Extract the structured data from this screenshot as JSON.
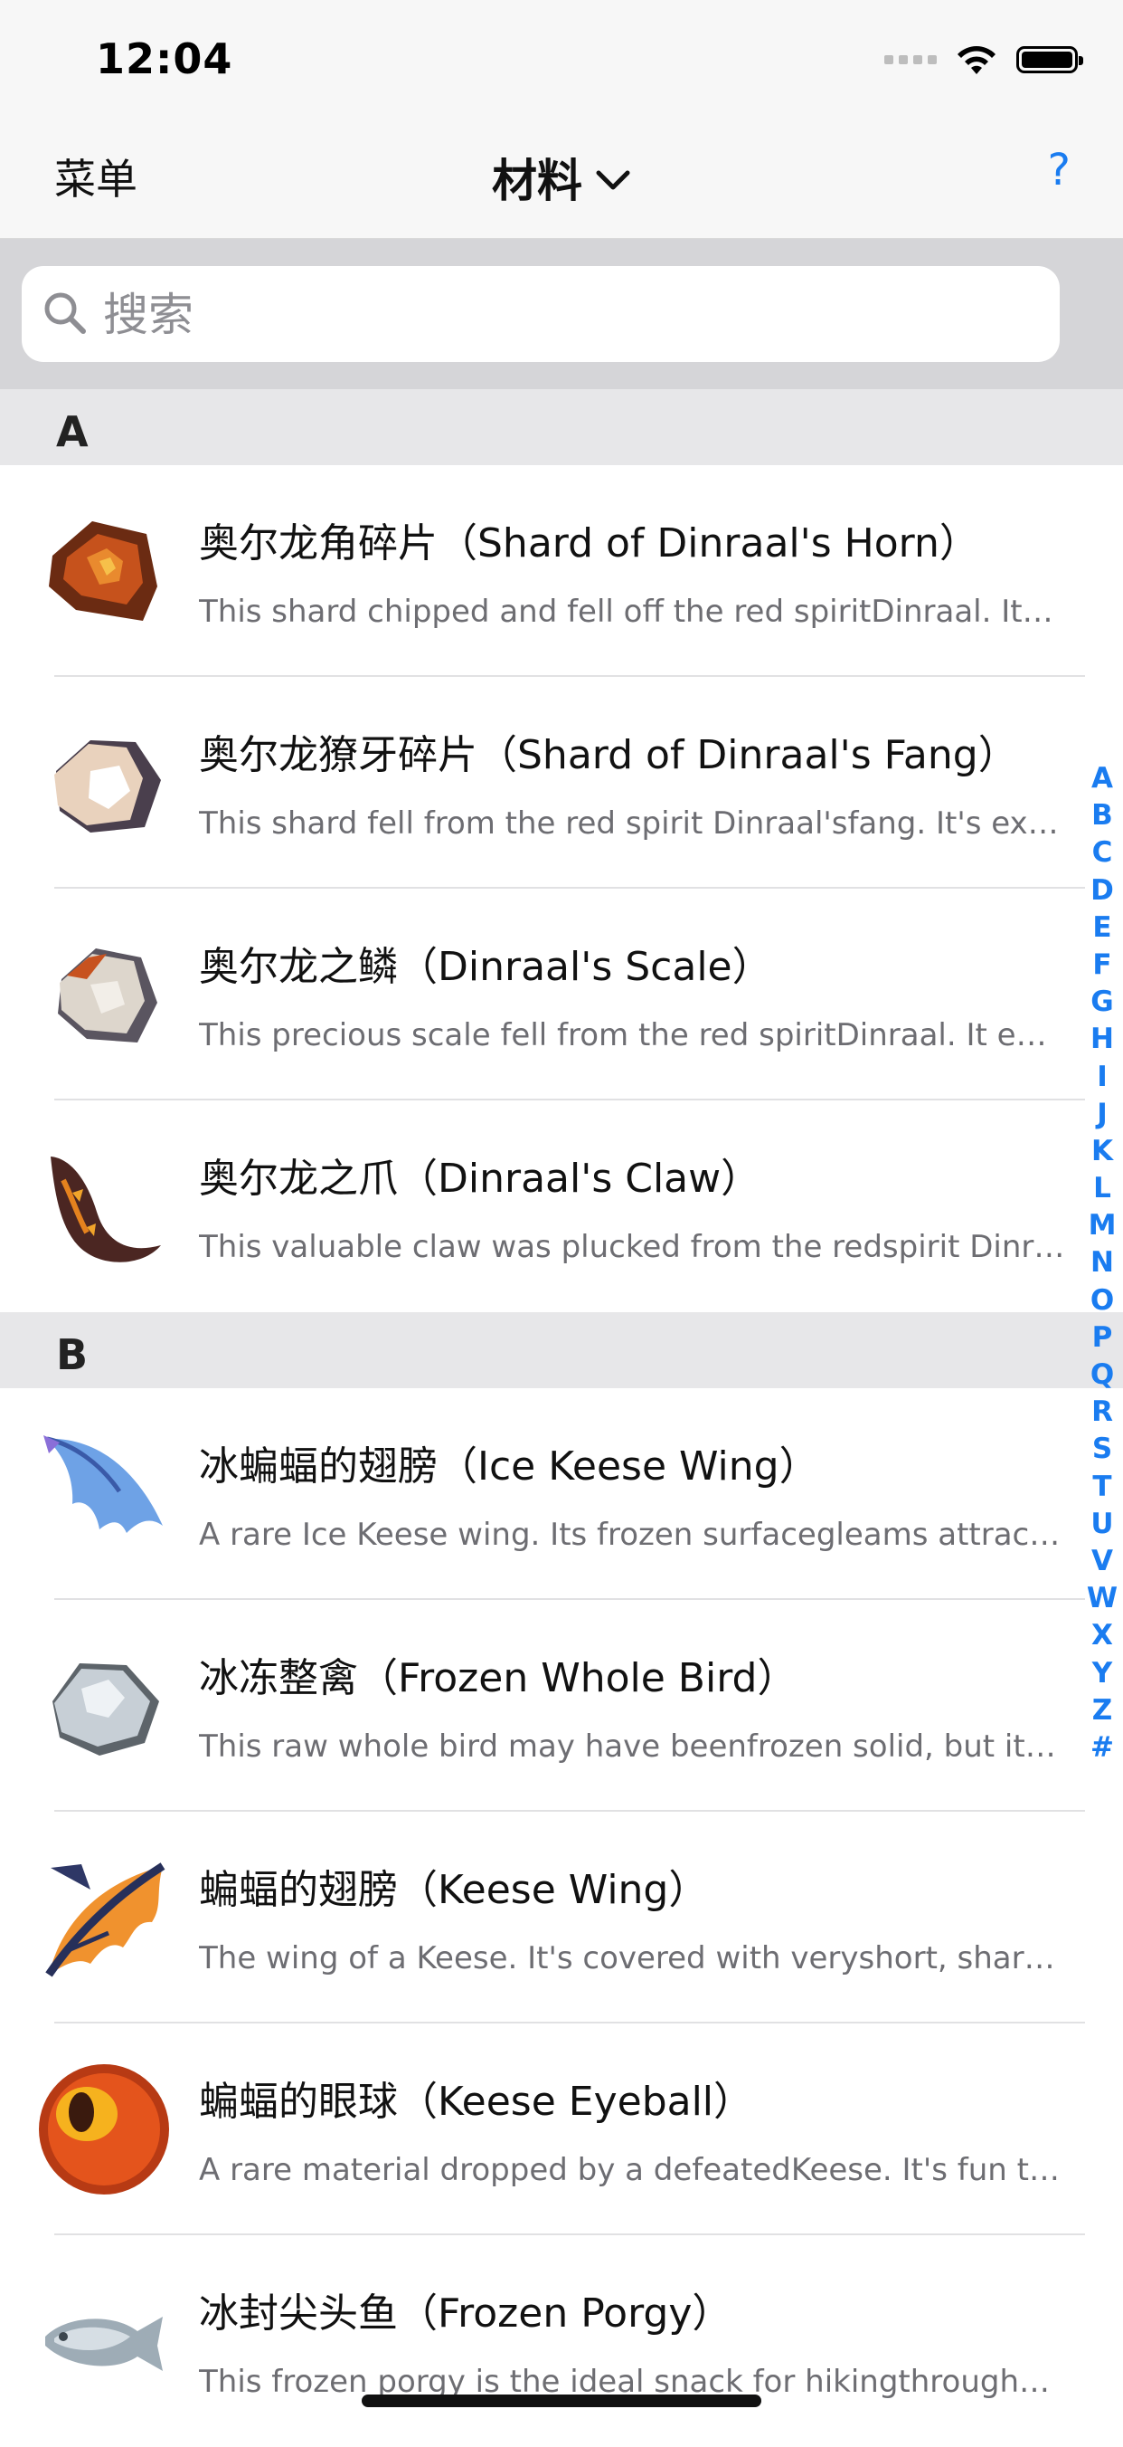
{
  "status_bar": {
    "time": "12:04"
  },
  "nav": {
    "left_label": "菜单",
    "title": "材料",
    "help_label": "?"
  },
  "search": {
    "placeholder": "搜索",
    "value": ""
  },
  "sections": [
    {
      "letter": "A",
      "items": [
        {
          "title": "奥尔龙角碎片（Shard of Dinraal's Horn）",
          "desc": "This shard chipped and fell off the red spiritDinraal. Its…",
          "icon": "horn-shard-icon",
          "color": "#9a3a12"
        },
        {
          "title": "奥尔龙獠牙碎片（Shard of Dinraal's Fang）",
          "desc": "This shard fell from the red spirit Dinraal'sfang. It's ex…",
          "icon": "fang-shard-icon",
          "color": "#e6cfb8"
        },
        {
          "title": "奥尔龙之鳞（Dinraal's Scale）",
          "desc": "This precious scale fell from the red spiritDinraal. It e…",
          "icon": "scale-icon",
          "color": "#d9d3ca"
        },
        {
          "title": "奥尔龙之爪（Dinraal's Claw）",
          "desc": "This valuable claw was plucked from the redspirit Dinr…",
          "icon": "claw-icon",
          "color": "#5a2a22"
        }
      ]
    },
    {
      "letter": "B",
      "items": [
        {
          "title": "冰蝙蝠的翅膀（Ice Keese Wing）",
          "desc": "A rare Ice Keese wing. Its frozen surfacegleams attrac…",
          "icon": "ice-keese-wing-icon",
          "color": "#5b8fd9"
        },
        {
          "title": "冰冻整禽（Frozen Whole Bird）",
          "desc": "This raw whole bird may have beenfrozen solid, but its…",
          "icon": "frozen-bird-icon",
          "color": "#b9c2c9"
        },
        {
          "title": "蝙蝠的翅膀（Keese Wing）",
          "desc": "The wing of a Keese. It's covered with veryshort, shar…",
          "icon": "keese-wing-icon",
          "color": "#e8892a"
        },
        {
          "title": "蝙蝠的眼球（Keese Eyeball）",
          "desc": "A rare material dropped by a defeatedKeese. It's fun t…",
          "icon": "keese-eyeball-icon",
          "color": "#e2521c"
        },
        {
          "title": "冰封尖头鱼（Frozen Porgy）",
          "desc": "This frozen porgy is the ideal snack for hikingthrough…",
          "icon": "frozen-porgy-icon",
          "color": "#a9b6bf"
        }
      ]
    }
  ],
  "index_letters": [
    "A",
    "B",
    "C",
    "D",
    "E",
    "F",
    "G",
    "H",
    "I",
    "J",
    "K",
    "L",
    "M",
    "N",
    "O",
    "P",
    "Q",
    "R",
    "S",
    "T",
    "U",
    "V",
    "W",
    "X",
    "Y",
    "Z",
    "#"
  ],
  "colors": {
    "accent": "#1a7cf0",
    "section_bg": "#e7e7e9",
    "search_bg": "#d5d5d8"
  }
}
